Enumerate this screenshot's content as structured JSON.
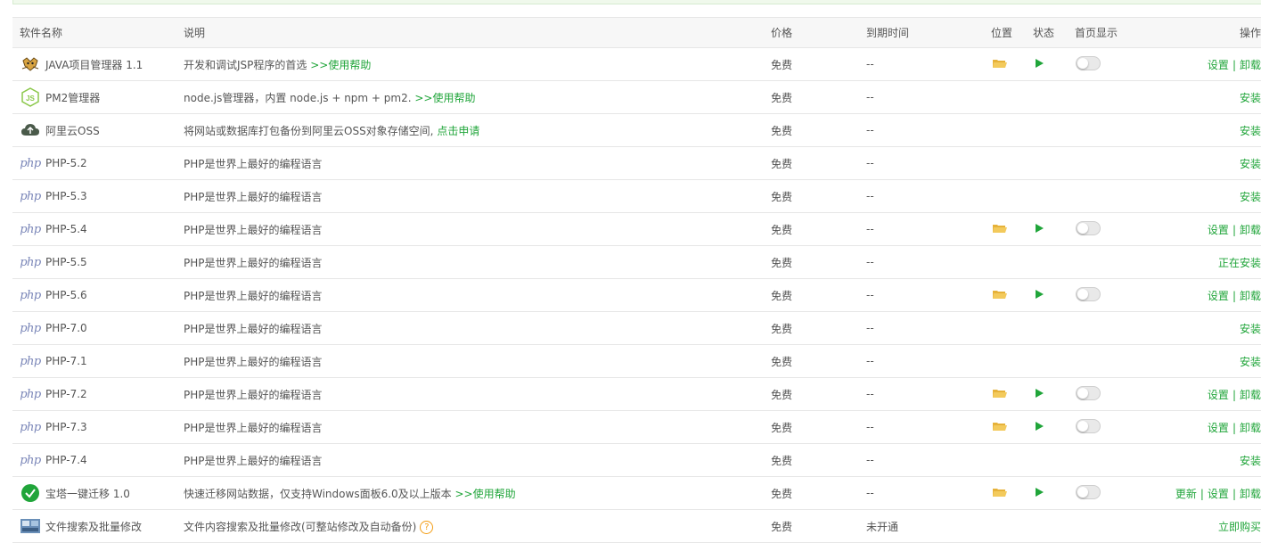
{
  "headers": {
    "name": "软件名称",
    "desc": "说明",
    "price": "价格",
    "expire": "到期时间",
    "location": "位置",
    "status": "状态",
    "home": "首页显示",
    "ops": "操作"
  },
  "rows": [
    {
      "icon": "tomcat-icon",
      "name": "JAVA项目管理器 1.1",
      "desc": "开发和调试JSP程序的首选",
      "desc_link": ">>使用帮助",
      "price": "免费",
      "expire": "--",
      "installed": true,
      "ops": [
        "设置",
        "卸载"
      ]
    },
    {
      "icon": "nodejs-icon",
      "name": "PM2管理器",
      "desc": "node.js管理器，内置 node.js + npm + pm2.",
      "desc_link": ">>使用帮助",
      "price": "免费",
      "expire": "--",
      "installed": false,
      "ops": [
        "安装"
      ]
    },
    {
      "icon": "aliyun-oss-icon",
      "name": "阿里云OSS",
      "desc": "将网站或数据库打包备份到阿里云OSS对象存储空间,",
      "desc_link": "点击申请",
      "price": "免费",
      "expire": "--",
      "installed": false,
      "ops": [
        "安装"
      ]
    },
    {
      "icon": "php-icon",
      "name": "PHP-5.2",
      "desc": "PHP是世界上最好的编程语言",
      "desc_link": "",
      "price": "免费",
      "expire": "--",
      "installed": false,
      "ops": [
        "安装"
      ]
    },
    {
      "icon": "php-icon",
      "name": "PHP-5.3",
      "desc": "PHP是世界上最好的编程语言",
      "desc_link": "",
      "price": "免费",
      "expire": "--",
      "installed": false,
      "ops": [
        "安装"
      ]
    },
    {
      "icon": "php-icon",
      "name": "PHP-5.4",
      "desc": "PHP是世界上最好的编程语言",
      "desc_link": "",
      "price": "免费",
      "expire": "--",
      "installed": true,
      "ops": [
        "设置",
        "卸载"
      ]
    },
    {
      "icon": "php-icon",
      "name": "PHP-5.5",
      "desc": "PHP是世界上最好的编程语言",
      "desc_link": "",
      "price": "免费",
      "expire": "--",
      "installed": false,
      "ops": [
        "正在安装"
      ]
    },
    {
      "icon": "php-icon",
      "name": "PHP-5.6",
      "desc": "PHP是世界上最好的编程语言",
      "desc_link": "",
      "price": "免费",
      "expire": "--",
      "installed": true,
      "ops": [
        "设置",
        "卸载"
      ]
    },
    {
      "icon": "php-icon",
      "name": "PHP-7.0",
      "desc": "PHP是世界上最好的编程语言",
      "desc_link": "",
      "price": "免费",
      "expire": "--",
      "installed": false,
      "ops": [
        "安装"
      ]
    },
    {
      "icon": "php-icon",
      "name": "PHP-7.1",
      "desc": "PHP是世界上最好的编程语言",
      "desc_link": "",
      "price": "免费",
      "expire": "--",
      "installed": false,
      "ops": [
        "安装"
      ]
    },
    {
      "icon": "php-icon",
      "name": "PHP-7.2",
      "desc": "PHP是世界上最好的编程语言",
      "desc_link": "",
      "price": "免费",
      "expire": "--",
      "installed": true,
      "ops": [
        "设置",
        "卸载"
      ]
    },
    {
      "icon": "php-icon",
      "name": "PHP-7.3",
      "desc": "PHP是世界上最好的编程语言",
      "desc_link": "",
      "price": "免费",
      "expire": "--",
      "installed": true,
      "ops": [
        "设置",
        "卸载"
      ]
    },
    {
      "icon": "php-icon",
      "name": "PHP-7.4",
      "desc": "PHP是世界上最好的编程语言",
      "desc_link": "",
      "price": "免费",
      "expire": "--",
      "installed": false,
      "ops": [
        "安装"
      ]
    },
    {
      "icon": "check-circle-icon",
      "name": "宝塔一键迁移 1.0",
      "desc": "快速迁移网站数据，仅支持Windows面板6.0及以上版本",
      "desc_link": ">>使用帮助",
      "price": "免费",
      "expire": "--",
      "installed": true,
      "ops": [
        "更新",
        "设置",
        "卸载"
      ]
    },
    {
      "icon": "file-search-icon",
      "name": "文件搜索及批量修改",
      "desc": "文件内容搜索及批量修改(可整站修改及自动备份)",
      "desc_link": "",
      "help": true,
      "price": "免费",
      "expire": "未开通",
      "installed": false,
      "ops": [
        "立即购买"
      ]
    }
  ],
  "colors": {
    "accent": "#20a53a",
    "header_bg": "#f7f7f7",
    "border": "#e6e6e6"
  }
}
